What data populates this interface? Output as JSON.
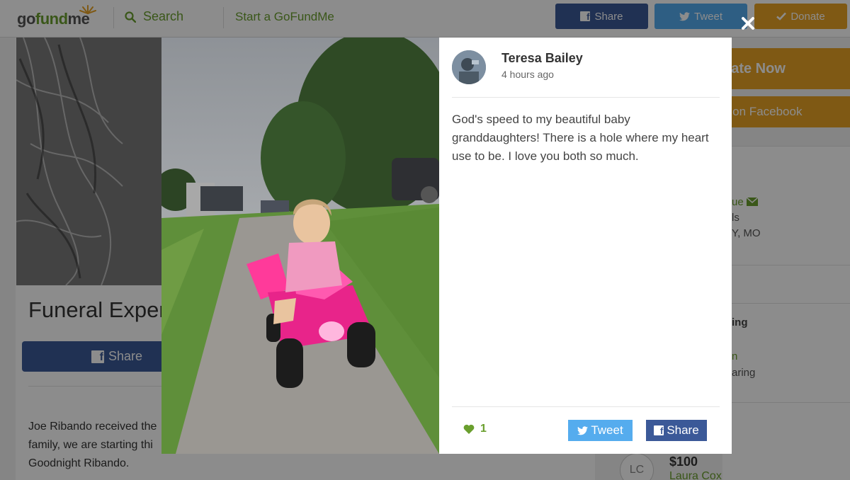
{
  "header": {
    "logo_text_go": "go",
    "logo_text_fund": "fund",
    "logo_text_me": "me",
    "search_label": "Search",
    "start_label": "Start a GoFundMe",
    "share_label": "Share",
    "tweet_label": "Tweet",
    "donate_label": "Donate"
  },
  "campaign": {
    "title": "Funeral Expen",
    "share_label": "Share",
    "story_lines": [
      "Joe Ribando received the",
      "family, we are starting thi",
      "Goodnight Ribando."
    ]
  },
  "sidebar": {
    "donate_now": "nate Now",
    "share_facebook": "e on Facebook",
    "organizer_name_fragment": "ue",
    "organizer_line2": "ls",
    "organizer_location": "Y, MO",
    "section_fragment": "ing",
    "sharing_fragment_green": "n",
    "sharing_fragment": "aring",
    "donation": {
      "initials": "LC",
      "amount": "$100",
      "donor": "Laura Cox"
    }
  },
  "modal": {
    "author": "Teresa Bailey",
    "time_ago": "4 hours ago",
    "message": "God's speed to my beautiful baby granddaughters! There is a hole where my heart use to be. I love you both so much.",
    "likes": "1",
    "tweet_label": "Tweet",
    "share_label": "Share"
  },
  "colors": {
    "brand_green": "#6a9f2e",
    "facebook": "#3b5998",
    "twitter": "#55acee",
    "donate": "#e8a326"
  },
  "icons": [
    "search-icon",
    "facebook-icon",
    "twitter-icon",
    "checkmark-icon",
    "close-icon",
    "heart-icon",
    "envelope-icon"
  ]
}
